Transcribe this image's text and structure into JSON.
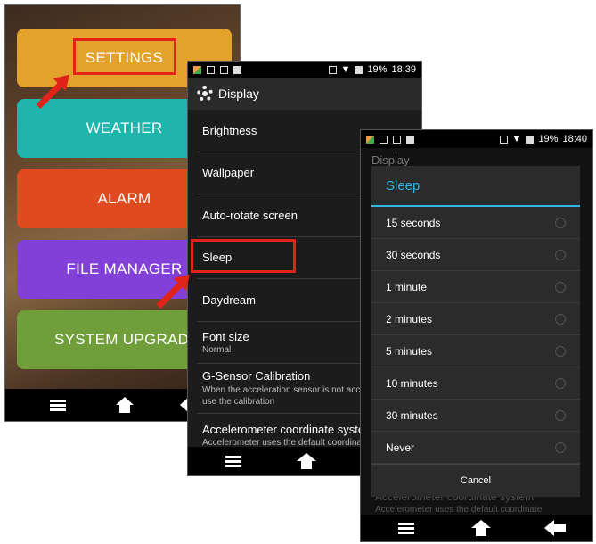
{
  "launcher": {
    "tiles": [
      {
        "label": "SETTINGS",
        "color": "#e3a22c"
      },
      {
        "label": "WEATHER",
        "color": "#1fb5ad"
      },
      {
        "label": "ALARM",
        "color": "#e04a1f"
      },
      {
        "label": "FILE MANAGER",
        "color": "#8240d8"
      },
      {
        "label": "SYSTEM UPGRADE",
        "color": "#6f9e3a"
      }
    ],
    "nav": [
      "menu-icon",
      "home-icon",
      "back-icon"
    ]
  },
  "display_screen": {
    "status": {
      "battery": "19%",
      "time": "18:39"
    },
    "title": "Display",
    "items": [
      {
        "title": "Brightness",
        "subtitle": ""
      },
      {
        "title": "Wallpaper",
        "subtitle": ""
      },
      {
        "title": "Auto-rotate screen",
        "subtitle": ""
      },
      {
        "title": "Sleep",
        "subtitle": ""
      },
      {
        "title": "Daydream",
        "subtitle": ""
      },
      {
        "title": "Font size",
        "subtitle": "Normal"
      },
      {
        "title": "G-Sensor Calibration",
        "subtitle": "When the acceleration sensor is not accurate, please use the calibration"
      },
      {
        "title": "Accelerometer coordinate system",
        "subtitle": "Accelerometer uses the default coordinate"
      }
    ]
  },
  "sleep_screen": {
    "status": {
      "battery": "19%",
      "time": "18:40"
    },
    "background_title": "Display",
    "background_item": {
      "title": "Accelerometer coordinate system",
      "subtitle": "Accelerometer uses the default coordinate"
    },
    "dialog": {
      "title": "Sleep",
      "options": [
        "15 seconds",
        "30 seconds",
        "1 minute",
        "2 minutes",
        "5 minutes",
        "10 minutes",
        "30 minutes",
        "Never"
      ],
      "cancel_label": "Cancel"
    }
  },
  "colors": {
    "highlight": "#e2231a",
    "holo_blue": "#33b5e5"
  }
}
